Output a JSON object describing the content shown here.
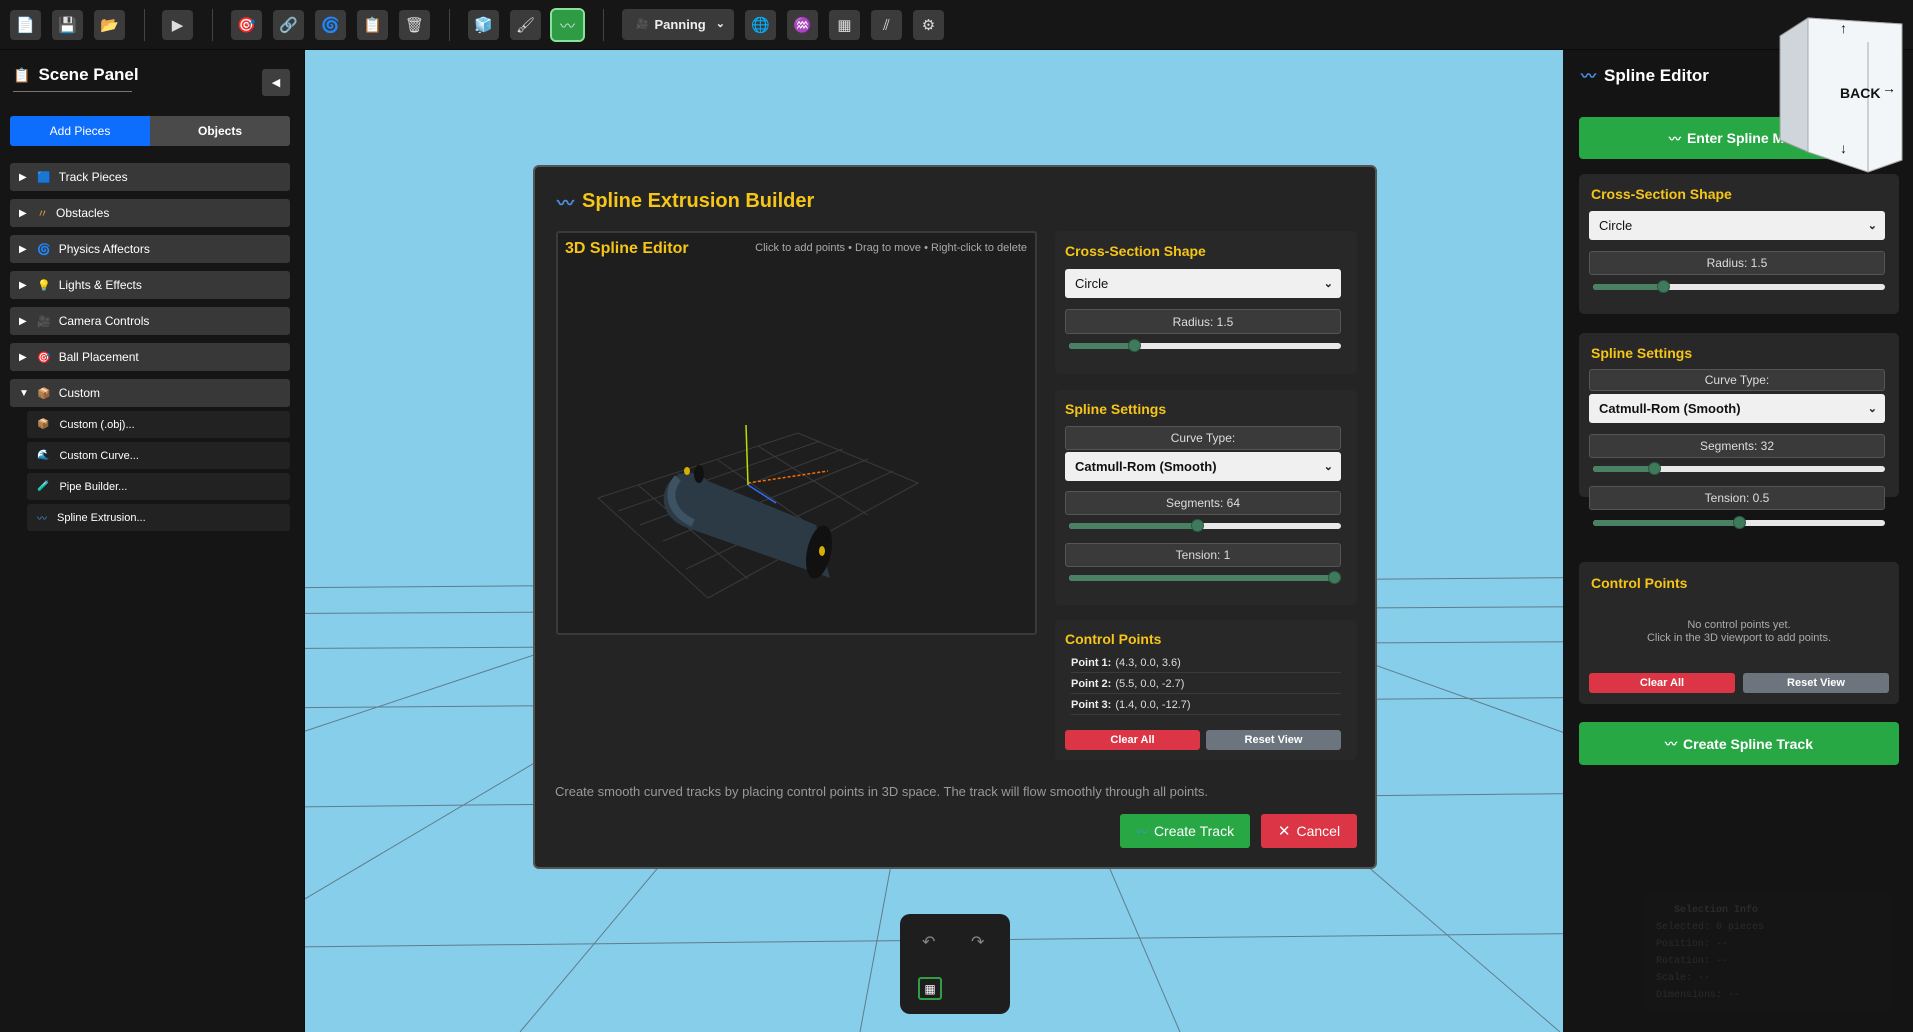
{
  "toolbar": {
    "buttons_left": [
      "new-file-icon",
      "save-icon",
      "open-folder-icon",
      "play-icon",
      "target-icon",
      "link-icon",
      "spiral-icon",
      "clipboard-icon",
      "trash-icon",
      "cube-icon",
      "brush-icon",
      "spline-icon"
    ],
    "mode_select": {
      "icon": "🎥",
      "value": "Panning"
    },
    "buttons_right": [
      "globe-icon",
      "physics-icon",
      "checker-icon",
      "speed-icon",
      "settings-icon"
    ]
  },
  "left_panel": {
    "title": "Scene Panel",
    "collapse": "◀",
    "tabs": {
      "add": "Add Pieces",
      "objects": "Objects"
    },
    "categories": [
      {
        "label": "Track Pieces",
        "icon": "🟦",
        "arrow": "▶"
      },
      {
        "label": "Obstacles",
        "icon": "〃",
        "arrow": "▶"
      },
      {
        "label": "Physics Affectors",
        "icon": "🌀",
        "arrow": "▶"
      },
      {
        "label": "Lights & Effects",
        "icon": "💡",
        "arrow": "▶"
      },
      {
        "label": "Camera Controls",
        "icon": "🎥",
        "arrow": "▶"
      },
      {
        "label": "Ball Placement",
        "icon": "🎯",
        "arrow": "▶"
      },
      {
        "label": "Custom",
        "icon": "📦",
        "arrow": "▼"
      }
    ],
    "custom_items": [
      {
        "label": "Custom (.obj)...",
        "icon": "📦"
      },
      {
        "label": "Custom Curve...",
        "icon": "🌊"
      },
      {
        "label": "Pipe Builder...",
        "icon": "🧪"
      },
      {
        "label": "Spline Extrusion...",
        "icon": "〰"
      }
    ]
  },
  "right_panel": {
    "title": "Spline Editor",
    "enter_button": "Enter Spline Mode",
    "cross_section": {
      "title": "Cross-Section Shape",
      "shape": "Circle",
      "radius_label": "Radius: 1.5",
      "radius_fraction": 0.24
    },
    "spline_settings": {
      "title": "Spline Settings",
      "curve_type_label": "Curve Type:",
      "curve_type": "Catmull-Rom (Smooth)",
      "segments_label": "Segments: 32",
      "segments_fraction": 0.21,
      "tension_label": "Tension: 0.5",
      "tension_fraction": 0.5
    },
    "control_points": {
      "title": "Control Points",
      "empty_line1": "No control points yet.",
      "empty_line2": "Click in the 3D viewport to add points.",
      "clear": "Clear All",
      "reset": "Reset View"
    },
    "create_button": "Create Spline Track"
  },
  "nav_cube": {
    "face": "BACK",
    "up": "↑",
    "down": "↓",
    "left": "←",
    "right": "→"
  },
  "modal": {
    "title": "Spline Extrusion Builder",
    "viewport": {
      "title": "3D Spline Editor",
      "hint": "Click to add points • Drag to move • Right-click to delete"
    },
    "cross_section": {
      "title": "Cross-Section Shape",
      "shape": "Circle",
      "radius_label": "Radius: 1.5",
      "radius_fraction": 0.24
    },
    "spline_settings": {
      "title": "Spline Settings",
      "curve_type_label": "Curve Type:",
      "curve_type": "Catmull-Rom (Smooth)",
      "segments_label": "Segments: 64",
      "segments_fraction": 0.47,
      "tension_label": "Tension: 1",
      "tension_fraction": 1.0
    },
    "control_points": {
      "title": "Control Points",
      "points": [
        {
          "name": "Point 1:",
          "coords": "(4.3, 0.0, 3.6)"
        },
        {
          "name": "Point 2:",
          "coords": "(5.5, 0.0, -2.7)"
        },
        {
          "name": "Point 3:",
          "coords": "(1.4, 0.0, -12.7)"
        }
      ],
      "clear": "Clear All",
      "reset": "Reset View"
    },
    "description": "Create smooth curved tracks by placing control points in 3D space. The track will flow smoothly through all points.",
    "create": "Create Track",
    "cancel": "Cancel"
  },
  "undo_widget": {
    "undo": "↶",
    "redo": "↷",
    "grid": "▦"
  },
  "selection_info": {
    "title": "Selection Info",
    "selected": "Selected: 0 pieces",
    "position": "Position: --",
    "rotation": "Rotation: --",
    "scale": "Scale: --",
    "dimensions": "Dimensions: --"
  }
}
